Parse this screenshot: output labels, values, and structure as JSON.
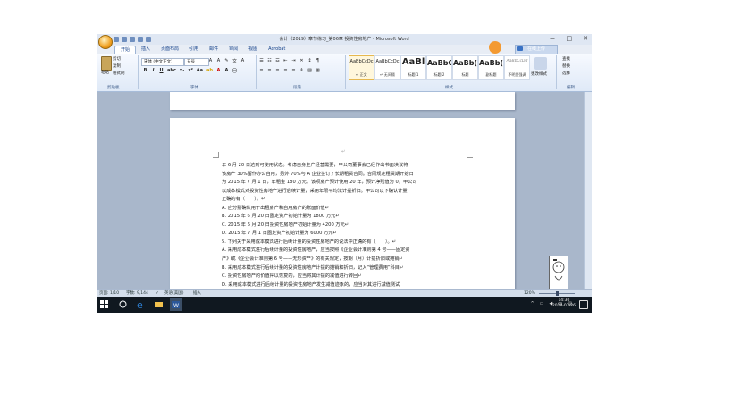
{
  "window": {
    "title": "会计（2019）章节练习_第06章 投资性房地产 - Microsoft Word",
    "controls": [
      "－",
      "□",
      "✕"
    ]
  },
  "ribbon_tabs": [
    "开始",
    "插入",
    "页面布局",
    "引用",
    "邮件",
    "审阅",
    "视图",
    "Acrobat"
  ],
  "share_button": "在线上传",
  "clipboard": {
    "paste_label": "粘贴",
    "cut_label": "剪切",
    "copy_label": "复制",
    "format_painter_label": "格式刷",
    "group_label": "剪贴板"
  },
  "font": {
    "font_name": "宋体 (中文正文)",
    "font_size": "五号",
    "group_label": "字体"
  },
  "paragraph": {
    "group_label": "段落"
  },
  "styles": {
    "group_label": "样式",
    "items": [
      {
        "sample": "AaBbCcDc",
        "name": "↵ 正文"
      },
      {
        "sample": "AaBbCcDc",
        "name": "↵ 无间隔"
      },
      {
        "sample": "AaBl",
        "name": "标题 1"
      },
      {
        "sample": "AaBbC",
        "name": "标题 2"
      },
      {
        "sample": "AaBb(",
        "name": "标题"
      },
      {
        "sample": "AaBb(",
        "name": "副标题"
      },
      {
        "sample": "AaBbCcDd",
        "name": "不明显强调"
      }
    ],
    "change_styles_label": "更改样式"
  },
  "editing": {
    "group_label": "编辑",
    "find_label": "查找",
    "replace_label": "替换",
    "select_label": "选择"
  },
  "document": {
    "paragraph_mark": "↵",
    "lines": [
      "年 6 月 20 日达到可使用状态。考虑自身生产经营需要，甲公司董事会已经作出书面决议将",
      "该房产 30%留作办公自用，另外 70%与 A 企业签订了长期租赁合同。合同规定租赁期开始日",
      "为 2015 年 7 月 1 日，年租金 180 万元。该项房产预计使用 20 年，预计净残值为 0，甲公司",
      "以成本模式对投资性房地产进行后续计量，采用年限平均法计提折旧。甲公司以下确认计量",
      "正确的有（　　）。↵",
      "A. 应分别确认用于出租房产和自用房产的账面价值↵",
      "B. 2015 年 6 月 20 日固定资产初始计量为 1800 万元↵",
      "C. 2015 年 6 月 20 日投资性房地产初始计量为 4200 万元↵",
      "D. 2015 年 7 月 1 日固定资产初始计量为 6000 万元↵",
      "5. 下列关于采用成本模式进行后续计量的投资性房地产的说法中正确的有（　　）。↵",
      "A. 采用成本模式进行后续计量的投资性房地产，应当按照《企业会计准则第 4 号——固定资",
      "产》或《企业会计准则第 6 号——无形资产》的有关规定，按期（月）计提折旧或摊销↵",
      "B. 采用成本模式进行后续计量的投资性房地产计提的摊销和折旧，记入“管理费用”科目↵",
      "C. 投资性房地产的价值得以恢复的，应当将其计提的减值进行转回↵",
      "D. 采用成本模式进行后续计量的投资性房地产发生减值迹象的，应当对其进行减值测试"
    ]
  },
  "statusbar": {
    "page": "页面: 1/10",
    "words": "字数: 9,144",
    "language": "英语(美国)",
    "mode": "插入",
    "zoom": "120%"
  },
  "taskbar": {
    "time": "14:30",
    "date": "2018-07-26",
    "ime": "中"
  }
}
